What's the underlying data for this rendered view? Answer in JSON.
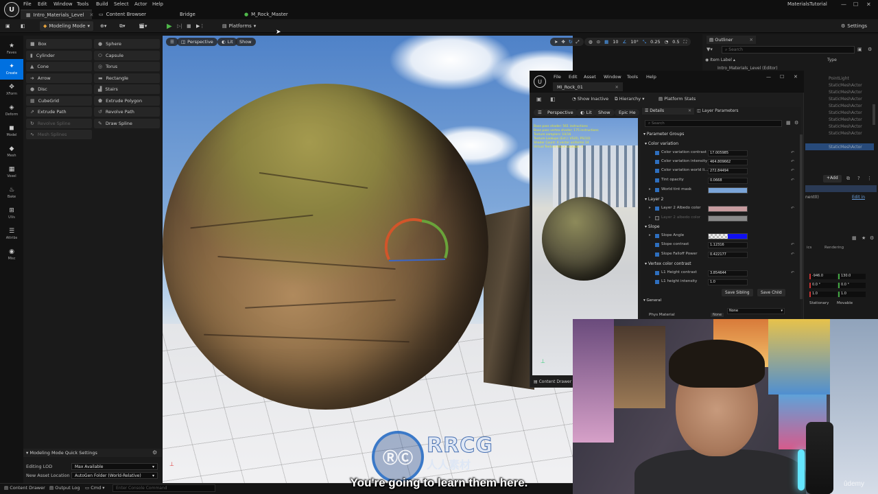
{
  "title_bar": {
    "menu": [
      "File",
      "Edit",
      "Window",
      "Tools",
      "Build",
      "Select",
      "Actor",
      "Help"
    ],
    "project": "MaterialsTutorial",
    "tabs": [
      {
        "label": "Intro_Materials_Level",
        "icon": "level-icon"
      },
      {
        "label": "Content Browser",
        "icon": "folder-icon"
      },
      {
        "label": "Bridge",
        "icon": "bridge-icon"
      },
      {
        "label": "M_Rock_Master",
        "icon": "material-icon"
      }
    ]
  },
  "toolbar": {
    "mode": "Modeling Mode",
    "platforms": "Platforms",
    "settings": "Settings"
  },
  "rail": [
    {
      "label": "Faves",
      "icon": "star-icon"
    },
    {
      "label": "Create",
      "icon": "create-icon",
      "active": true
    },
    {
      "label": "XForm",
      "icon": "transform-icon"
    },
    {
      "label": "Deform",
      "icon": "deform-icon"
    },
    {
      "label": "Model",
      "icon": "model-icon"
    },
    {
      "label": "Mesh",
      "icon": "mesh-icon"
    },
    {
      "label": "Voxel",
      "icon": "voxel-icon"
    },
    {
      "label": "Bake",
      "icon": "bake-icon"
    },
    {
      "label": "UVs",
      "icon": "uv-icon"
    },
    {
      "label": "Attribs",
      "icon": "attributes-icon"
    },
    {
      "label": "Misc",
      "icon": "misc-icon"
    }
  ],
  "shapes": {
    "left": [
      "Box",
      "Cylinder",
      "Cone",
      "Arrow",
      "Disc",
      "CubeGrid",
      "Extrude Path",
      "Revolve Spline",
      "Mesh Splines"
    ],
    "right": [
      "Sphere",
      "Capsule",
      "Torus",
      "Rectangle",
      "Stairs",
      "Extrude Polygon",
      "Revolve Path",
      "Draw Spline"
    ],
    "disabled": [
      "Revolve Spline",
      "Mesh Splines"
    ]
  },
  "quick_settings": {
    "header": "Modeling Mode Quick Settings",
    "editing_lod_label": "Editing LOD",
    "editing_lod_value": "Max Available",
    "new_asset_label": "New Asset Location",
    "new_asset_value": "AutoGen Folder (World-Relative)"
  },
  "viewport": {
    "perspective": "Perspective",
    "lit": "Lit",
    "show": "Show",
    "right_tools": [
      "10",
      "10°",
      "0.25",
      "0.5"
    ]
  },
  "outliner": {
    "title": "Outliner",
    "search_placeholder": "Search",
    "col_label": "Item Label",
    "col_type": "Type",
    "level": "Intro_Materials_Level (Editor)",
    "types": [
      "PointLight",
      "StaticMeshActor",
      "StaticMeshActor",
      "StaticMeshActor",
      "StaticMeshActor",
      "StaticMeshActor",
      "StaticMeshActor",
      "StaticMeshActor",
      "StaticMeshActor",
      "StaticMeshActor"
    ],
    "add": "Add",
    "edit_in": "Edit in",
    "component": "nent0)",
    "tab_rendering": "Rendering",
    "tab_cs": "ics",
    "xform": [
      [
        "-946.0",
        "130.0"
      ],
      [
        "0.0 °",
        "0.0 °"
      ],
      [
        "1.0",
        "1.0"
      ]
    ],
    "mobility": [
      "Stationary",
      "Movable"
    ]
  },
  "mi_editor": {
    "menu": [
      "File",
      "Edit",
      "Asset",
      "Window",
      "Tools",
      "Help"
    ],
    "tab": "MI_Rock_01",
    "show_inactive": "Show Inactive",
    "hierarchy": "Hierarchy",
    "platform_stats": "Platform Stats",
    "preview_perspective": "Perspective",
    "preview_lit": "Lit",
    "preview_show": "Show",
    "preview_epic": "Epic He",
    "overlay_lines": [
      "Base pass shader: 561 instructions",
      "Base pass vertex shader: 175 instructions",
      "Texture samplers: 10/16",
      "Texture Lookups (Est.): VS(0), PS(10)",
      "Shader Count: 4 vector uniforms 14",
      "Virtual Texture Stack Lookups: 0"
    ],
    "content_drawer": "Content Drawer",
    "details_tab": "Details",
    "layer_tab": "Layer Parameters",
    "search_placeholder": "Search",
    "groups_header": "Parameter Groups",
    "groups": [
      {
        "name": "Color variation",
        "params": [
          {
            "label": "Color variation contrast",
            "value": "17.005985",
            "on": true
          },
          {
            "label": "Color variation intensity",
            "value": "464.809662",
            "on": true
          },
          {
            "label": "Color variation world li...",
            "value": "272.84494",
            "on": true
          },
          {
            "label": "Tint opacity",
            "value": "0.0668",
            "on": true
          },
          {
            "label": "World tint mask",
            "swatch": "#7aa4d8",
            "on": true
          }
        ]
      },
      {
        "name": "Layer 2",
        "params": [
          {
            "label": "Layer 2 Albedo color",
            "swatch": "#c79c9f",
            "on": true
          },
          {
            "label": "Layer 2 albedo color",
            "swatch": "#8a8a8a",
            "on": false
          }
        ]
      },
      {
        "name": "Slope",
        "params": [
          {
            "label": "Slope Angle",
            "swatch": "#1010f0",
            "checker": true,
            "on": true
          },
          {
            "label": "Slope contrast",
            "value": "1.12316",
            "on": true
          },
          {
            "label": "Slope Falloff Power",
            "value": "0.422177",
            "on": true
          }
        ]
      },
      {
        "name": "Vertex color contrast",
        "params": [
          {
            "label": "L1 Height contrast",
            "value": "3.854644",
            "on": true
          },
          {
            "label": "L1 height intensity",
            "value": "1.0",
            "on": true
          }
        ]
      }
    ],
    "save_sibling": "Save Sibling",
    "save_child": "Save Child",
    "general": "General",
    "phys_material": "Phys Material",
    "phys_none": "None",
    "phys_value": "None"
  },
  "bottom": {
    "content_drawer": "Content Drawer",
    "output_log": "Output Log",
    "cmd": "Cmd",
    "console_placeholder": "Enter Console Command"
  },
  "watermark": {
    "logo": "RRCG",
    "sub": "人人素材"
  },
  "subtitle": "You're going to learn them here.",
  "udemy": "ûdemy"
}
